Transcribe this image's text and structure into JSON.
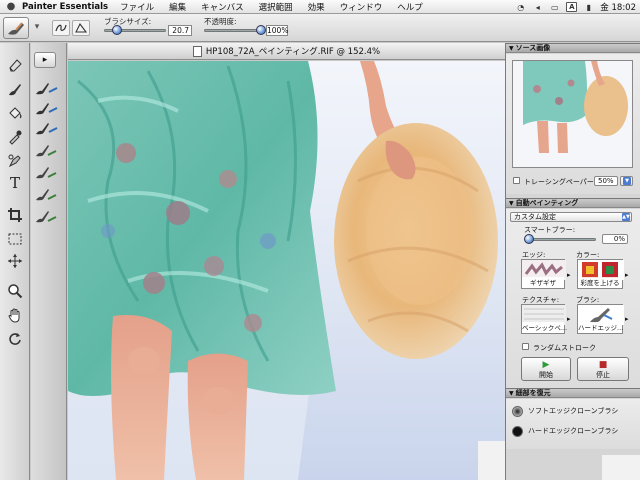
{
  "menubar": {
    "app_name": "Painter Essentials",
    "menus": [
      "ファイル",
      "編集",
      "キャンバス",
      "選択範囲",
      "効果",
      "ウィンドウ",
      "ヘルプ"
    ],
    "status_letter": "A",
    "clock": "金 18:02"
  },
  "property_bar": {
    "brush_size_label": "ブラシサイズ:",
    "brush_size_value": "20.7",
    "brush_size_fraction": 0.2,
    "opacity_label": "不透明度:",
    "opacity_value": "100%",
    "opacity_fraction": 1.0
  },
  "document": {
    "title": "HP108_72A_ペインティング.RIF @ 152.4%"
  },
  "source_panel": {
    "title": "ソース画像",
    "tracing_label": "トレーシングペーパー",
    "tracing_checked": false,
    "tracing_value": "50%"
  },
  "auto_paint": {
    "title": "自動ペインティング",
    "preset": "カスタム設定",
    "smart_blur_label": "スマートブラー:",
    "smart_blur_value": "0%",
    "smart_blur_fraction": 0.0,
    "edge_label": "エッジ:",
    "edge_value": "ギザギザ",
    "color_label": "カラー:",
    "color_value": "彩度を上げる",
    "texture_label": "テクスチャ:",
    "texture_value": "ベーシックペ...",
    "brush_label": "ブラシ:",
    "brush_value": "ハードエッジ...",
    "random_stroke_label": "ランダムストローク",
    "random_stroke_checked": false,
    "start_label": "開始",
    "stop_label": "停止",
    "start_color": "#2f9b3a",
    "stop_color": "#b52a2a"
  },
  "restore": {
    "title": "細部を復元",
    "items": [
      {
        "label": "ソフトエッジクローンブラシ"
      },
      {
        "label": "ハードエッジクローンブラシ"
      }
    ]
  }
}
